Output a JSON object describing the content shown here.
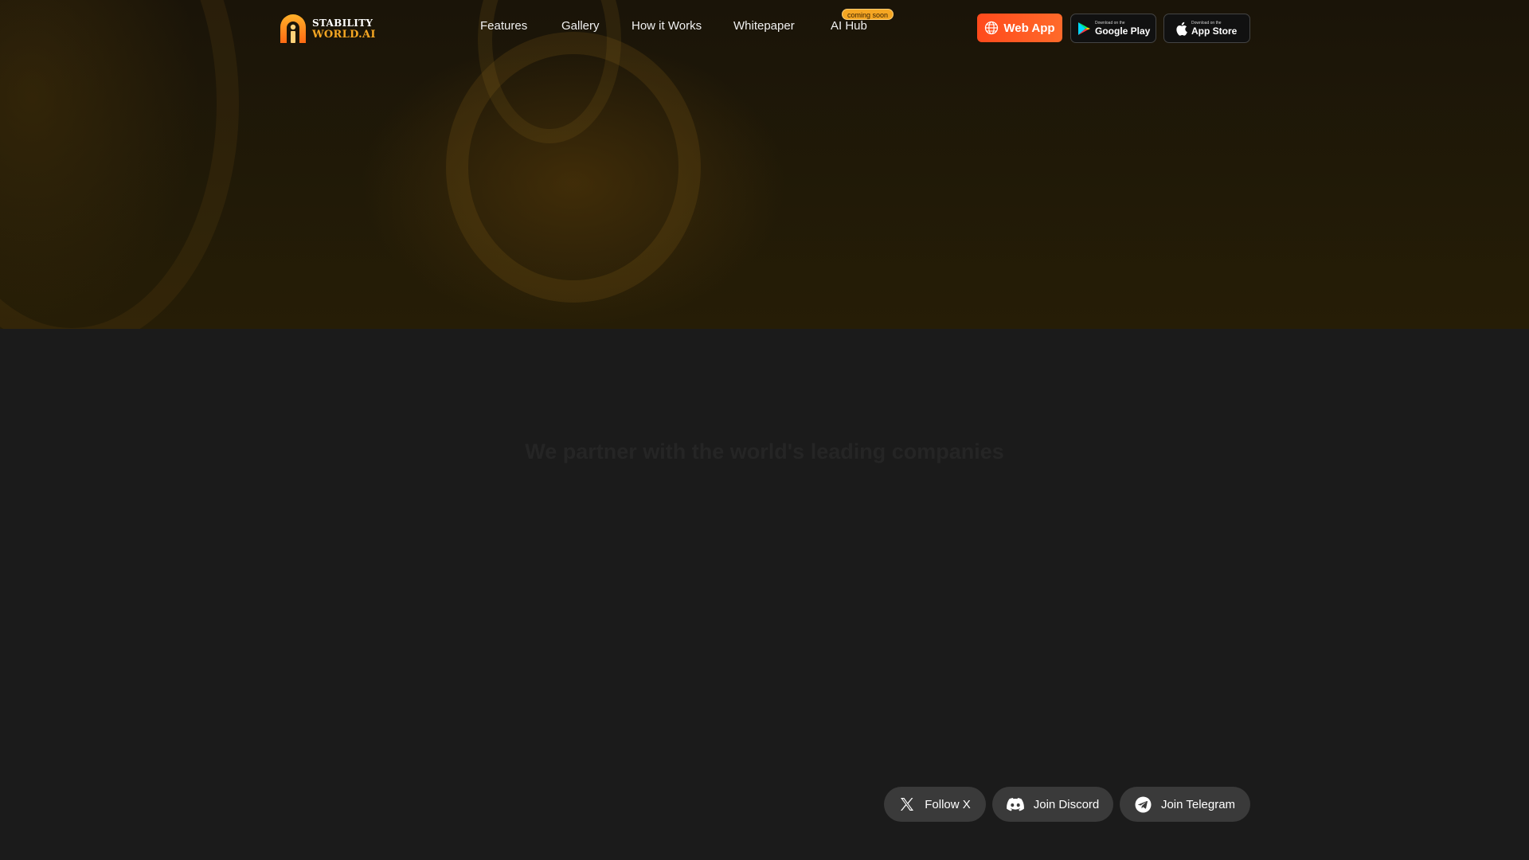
{
  "brand": {
    "line1": "STABILITY",
    "line2": "WORLD.AI",
    "accent": "#f5a623"
  },
  "nav": {
    "items": [
      {
        "label": "Features"
      },
      {
        "label": "Gallery"
      },
      {
        "label": "How it Works"
      },
      {
        "label": "Whitepaper"
      },
      {
        "label": "AI Hub"
      }
    ],
    "badge": "coming soon"
  },
  "actions": {
    "web_app": "Web App",
    "google_play": {
      "small": "Download on the",
      "big": "Google Play"
    },
    "app_store": {
      "small": "Download on the",
      "big": "App Store"
    }
  },
  "section": {
    "heading": "We partner with the world's leading companies"
  },
  "social": {
    "x": "Follow X",
    "discord": "Join Discord",
    "telegram": "Join Telegram"
  },
  "colors": {
    "primary_button": "#ff4a1c",
    "background": "#1b1b1b",
    "social_button": "#3a3a3a"
  },
  "icons": [
    "globe-icon",
    "google-play-icon",
    "apple-icon",
    "x-icon",
    "discord-icon",
    "telegram-icon"
  ]
}
